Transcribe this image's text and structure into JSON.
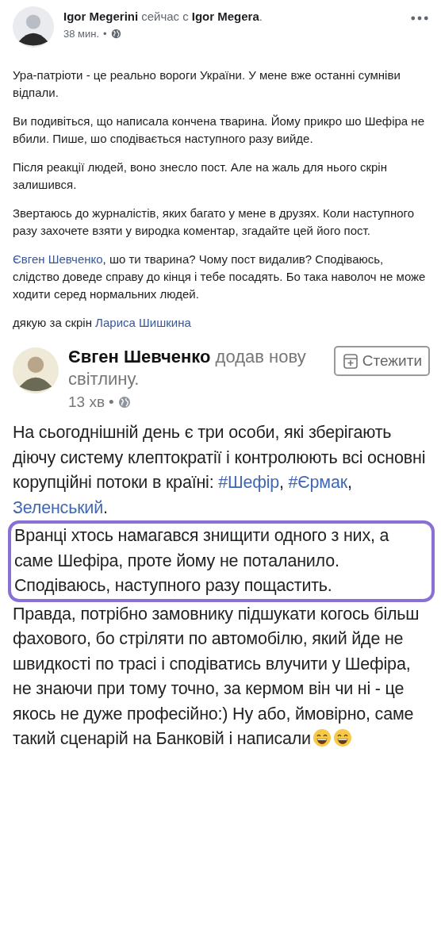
{
  "post": {
    "author": "Igor Megerini",
    "with_text": "сейчас с",
    "tagged": "Igor Megera",
    "period": ".",
    "time": "38 мин.",
    "separator": "•",
    "paragraphs": [
      [
        {
          "kind": "text",
          "text": "Ура-патріоти - це реально вороги України. У мене вже останні сумніви відпали."
        }
      ],
      [
        {
          "kind": "text",
          "text": "Ви подивіться, що написала кончена тварина. Йому прикро шо Шефіра не вбили. Пише, шо сподівається наступного разу вийде."
        }
      ],
      [
        {
          "kind": "text",
          "text": "Після реакції людей, воно знесло пост. Але на жаль для нього скрін залишився."
        }
      ],
      [
        {
          "kind": "text",
          "text": "Звертаюсь до журналістів, яких багато у мене в друзях. Коли наступного разу захочете взяти у виродка коментар, згадайте цей його пост."
        }
      ],
      [
        {
          "kind": "link",
          "text": "Євген Шевченко"
        },
        {
          "kind": "text",
          "text": ", шо ти тварина? Чому пост видалив? Сподіваюсь, слідство доведе справу до кінця і тебе посадять. Бо така наволоч не може ходити серед нормальних людей."
        }
      ],
      [
        {
          "kind": "text",
          "text": "дякую за скрін "
        },
        {
          "kind": "link",
          "text": "Лариса Шишкина"
        }
      ]
    ]
  },
  "shared": {
    "author": "Євген Шевченко",
    "action": "додав нову світлину.",
    "follow_button": "Стежити",
    "time": "13 хв",
    "separator": "•",
    "paragraphs": [
      {
        "highlighted": false,
        "segments": [
          {
            "kind": "text",
            "text": "На сьогоднішній день є три особи, які зберігають діючу систему клептократії і контролюють всі основні корупційні потоки в країні: "
          },
          {
            "kind": "link",
            "text": "#Шефір"
          },
          {
            "kind": "text",
            "text": ", "
          },
          {
            "kind": "link",
            "text": "#Єрмак"
          },
          {
            "kind": "text",
            "text": ", "
          },
          {
            "kind": "link",
            "text": "Зеленський"
          },
          {
            "kind": "text",
            "text": "."
          }
        ]
      },
      {
        "highlighted": true,
        "segments": [
          {
            "kind": "text",
            "text": "Вранці хтось намагався знищити одного з них, а саме Шефіра, проте йому не поталанило. Сподіваюсь, наступного разу пощастить."
          }
        ]
      },
      {
        "highlighted": false,
        "segments": [
          {
            "kind": "text",
            "text": "Правда, потрібно замовнику підшукати когось більш фахового, бо стріляти по автомобілю, який йде не швидкості по трасі і сподіватись влучити у Шефіра, не знаючи при тому точно, за кермом він чи ні - це якось не дуже професійно:) Ну або, ймовірно, саме такий сценарій на Банковій і написали"
          },
          {
            "kind": "emoji"
          },
          {
            "kind": "emoji"
          }
        ]
      }
    ]
  }
}
